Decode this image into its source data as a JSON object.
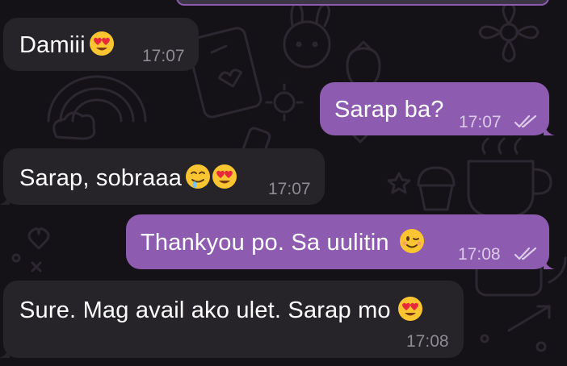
{
  "colors": {
    "background": "#151217",
    "incoming_bubble": "#262429",
    "outgoing_bubble": "#8d5bb0",
    "incoming_time": "#8f8b93",
    "outgoing_time": "#dccbe8",
    "text": "#ffffff"
  },
  "messages": [
    {
      "direction": "incoming",
      "text": "Damiii",
      "emoji": [
        "heart-eyes-emoji"
      ],
      "time": "17:07"
    },
    {
      "direction": "outgoing",
      "text": "Sarap ba?",
      "emoji": [],
      "time": "17:07",
      "status": "read-double-check-icon"
    },
    {
      "direction": "incoming",
      "text": "Sarap, sobraaa",
      "emoji": [
        "drooling-face-emoji",
        "heart-eyes-emoji"
      ],
      "time": "17:07"
    },
    {
      "direction": "outgoing",
      "text": "Thankyou po. Sa uulitin",
      "emoji": [
        "winking-face-emoji"
      ],
      "time": "17:08",
      "status": "read-double-check-icon"
    },
    {
      "direction": "incoming",
      "text": "Sure. Mag avail ako ulet. Sarap mo",
      "emoji": [
        "heart-eyes-emoji"
      ],
      "time": "17:08"
    }
  ]
}
